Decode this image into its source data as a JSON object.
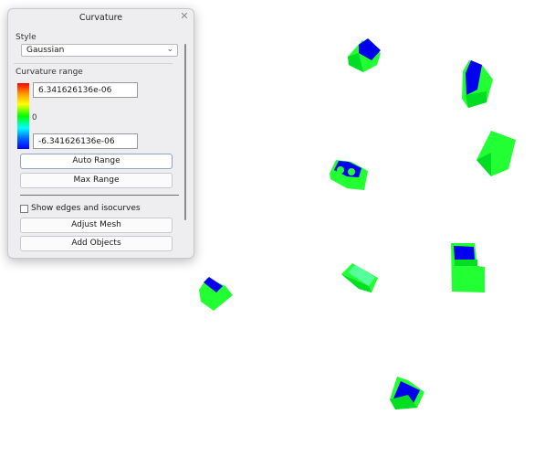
{
  "panel": {
    "title": "Curvature",
    "style_label": "Style",
    "style_value": "Gaussian",
    "range_label": "Curvature range",
    "range_max": "6.341626136e-06",
    "range_min": "-6.341626136e-06",
    "zero_label": "0",
    "auto_range": "Auto Range",
    "max_range": "Max Range",
    "show_edges": "Show edges and isocurves",
    "show_edges_checked": false,
    "adjust_mesh": "Adjust Mesh",
    "add_objects": "Add Objects"
  },
  "colors": {
    "positive": "#ff0000",
    "zero": "#00ff00",
    "negative": "#0000ff",
    "object_green": "#00ff22",
    "object_blue": "#0000ee"
  }
}
